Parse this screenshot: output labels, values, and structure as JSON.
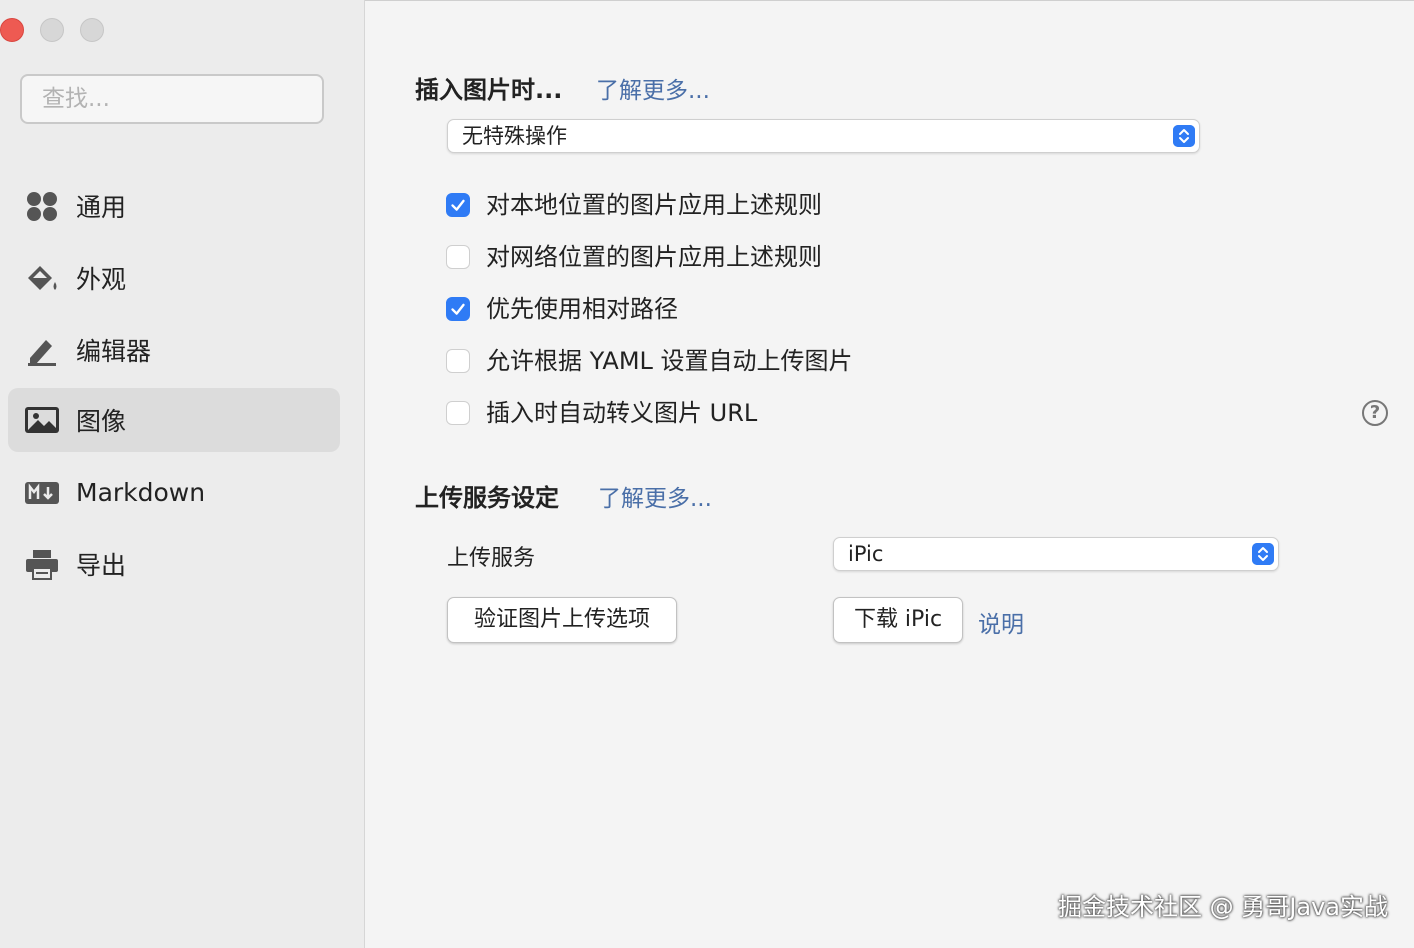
{
  "sidebar": {
    "search_placeholder": "查找...",
    "items": [
      {
        "label": "通用",
        "icon": "grid-circles-icon"
      },
      {
        "label": "外观",
        "icon": "paint-bucket-icon"
      },
      {
        "label": "编辑器",
        "icon": "pencil-icon"
      },
      {
        "label": "图像",
        "icon": "image-icon",
        "selected": true
      },
      {
        "label": "Markdown",
        "icon": "markdown-icon"
      },
      {
        "label": "导出",
        "icon": "printer-icon"
      }
    ]
  },
  "insert_section": {
    "title": "插入图片时...",
    "learn_more": "了解更多...",
    "select_value": "无特殊操作",
    "checkboxes": [
      {
        "label": "对本地位置的图片应用上述规则",
        "checked": true
      },
      {
        "label": "对网络位置的图片应用上述规则",
        "checked": false
      },
      {
        "label": "优先使用相对路径",
        "checked": true
      },
      {
        "label": "允许根据 YAML 设置自动上传图片",
        "checked": false
      },
      {
        "label": "插入时自动转义图片 URL",
        "checked": false
      }
    ],
    "help_icon": "question-circle-icon"
  },
  "upload_section": {
    "title": "上传服务设定",
    "learn_more": "了解更多...",
    "service_label": "上传服务",
    "service_value": "iPic",
    "verify_button": "验证图片上传选项",
    "download_button": "下载 iPic",
    "explain_link": "说明"
  },
  "watermark": "掘金技术社区 @ 勇哥Java实战",
  "colors": {
    "accent": "#2f7bf5",
    "link": "#4a6fa8",
    "close": "#ee5a52"
  }
}
